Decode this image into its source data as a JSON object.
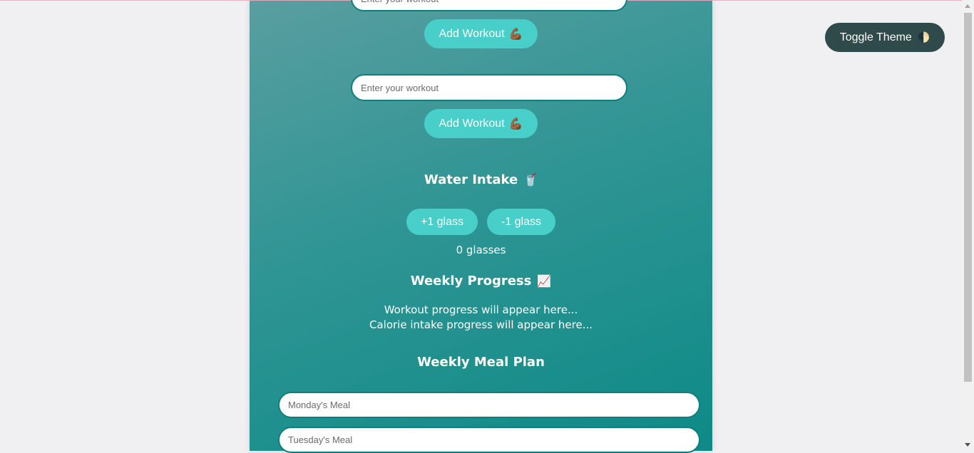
{
  "workout": {
    "input1": {
      "placeholder": "Enter your workout"
    },
    "input2": {
      "placeholder": "Enter your workout"
    },
    "add_button_label": "Add Workout",
    "add_button_icon": "💪🏾"
  },
  "water": {
    "title": "Water Intake",
    "title_icon": "🥤",
    "plus_label": "+1 glass",
    "minus_label": "-1 glass",
    "count_text": "0 glasses"
  },
  "progress": {
    "title": "Weekly Progress",
    "title_icon": "📈",
    "workout_text": "Workout progress will appear here...",
    "calorie_text": "Calorie intake progress will appear here..."
  },
  "meal_plan": {
    "title": "Weekly Meal Plan",
    "monday_placeholder": "Monday's Meal",
    "tuesday_placeholder": "Tuesday's Meal"
  },
  "theme": {
    "toggle_label": "Toggle Theme",
    "toggle_icon": "🌓"
  },
  "colors": {
    "panel_gradient_start": "#5a9ea0",
    "panel_gradient_end": "#0d8a87",
    "button": "#49cfca",
    "toggle_button": "#2e4a4a"
  }
}
